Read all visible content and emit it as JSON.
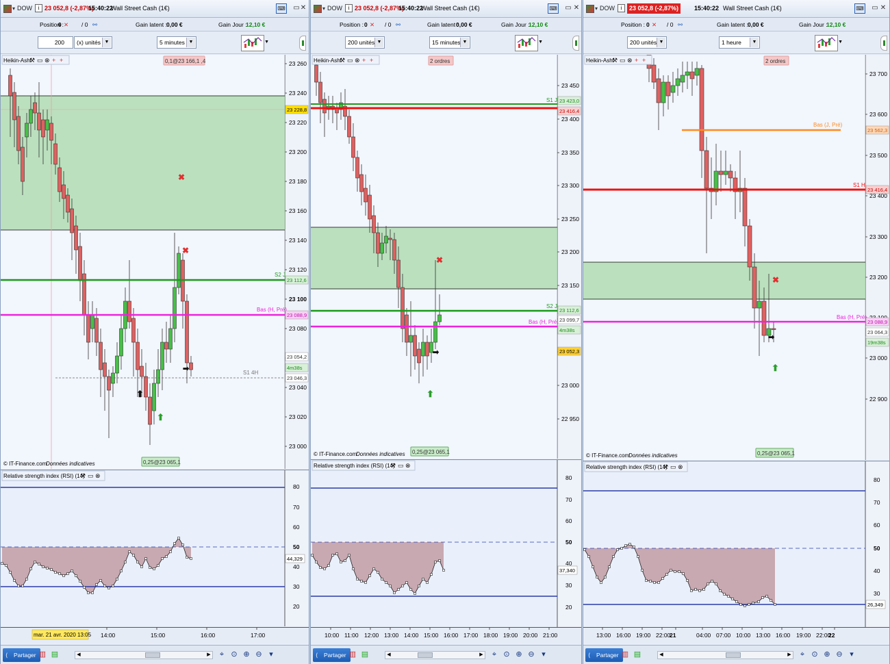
{
  "windows": [
    {
      "symbol": "DOW",
      "price_change": "23 052,8 (-2,87%)",
      "time": "15:40:22",
      "instrument": "Wall Street Cash (1€)",
      "position_label": "Position :",
      "position_value": "0",
      "position_sep": "/ 0",
      "latent_label": "Gain latent :",
      "latent_value": "0,00 €",
      "gain_label": "Gain Jour :",
      "gain_value": "12,10 €",
      "qty_value": "200",
      "units_select": "(x) unités",
      "period_select": "5 minutes",
      "indicator_label": "Heikin-Ashi",
      "order_badge": "0,1@23 166,1 ,4",
      "source_label": "© IT-Finance.com",
      "source_note": "Données indicatives",
      "fill_badge": "0,25@23 065,1",
      "rsi_label": "Relative strength index (RSI) (14)",
      "price_axis": [
        "23 260",
        "23 240",
        "23 220",
        "23 200",
        "23 180",
        "23 160",
        "23 140",
        "23 120",
        "23 100",
        "23 080",
        "23 060",
        "23 040",
        "23 020",
        "23 000"
      ],
      "price_tags": [
        {
          "text": "23 228,8",
          "kind": "yellow"
        },
        {
          "text": "23 112,6",
          "kind": "green"
        },
        {
          "text": "23 088,9",
          "kind": "magenta"
        },
        {
          "text": "23 054,2",
          "kind": "plain"
        },
        {
          "text": "4m38s",
          "kind": "green"
        },
        {
          "text": "23 046,3",
          "kind": "plain"
        }
      ],
      "line_labels": [
        {
          "text": "S2 J",
          "kind": "green"
        },
        {
          "text": "Bas (H, Pré)",
          "kind": "magenta"
        },
        {
          "text": "S1 4H",
          "kind": "gray"
        }
      ],
      "rsi_axis": [
        "80",
        "70",
        "60",
        "50",
        "40",
        "30",
        "20"
      ],
      "rsi_value": "44,329",
      "time_axis": [
        "14:00",
        "15:00",
        "16:00",
        "17:00"
      ],
      "date_cursor": "mar. 21 avr. 2020 13:05",
      "share_label": "Partager"
    },
    {
      "symbol": "DOW",
      "price_change": "23 052,8 (-2,87%)",
      "time": "15:40:22",
      "instrument": "Wall Street Cash (1€)",
      "position_label": "Position :",
      "position_value": "0",
      "position_sep": "/ 0",
      "latent_label": "Gain latent :",
      "latent_value": "0,00 €",
      "gain_label": "Gain Jour :",
      "gain_value": "12,10 €",
      "units_select": "200 unités",
      "period_select": "15 minutes",
      "indicator_label": "Heikin-Ashi",
      "order_badge": "2 ordres",
      "source_label": "© IT-Finance.com",
      "source_note": "Données indicatives",
      "fill_badge": "0,25@23 065,1",
      "rsi_label": "Relative strength index (RSI) (14)",
      "price_axis": [
        "23 450",
        "23 400",
        "23 350",
        "23 300",
        "23 250",
        "23 200",
        "23 150",
        "23 100",
        "23 050",
        "23 000",
        "22 950"
      ],
      "price_tags": [
        {
          "text": "23 423,0",
          "kind": "green"
        },
        {
          "text": "23 416,4",
          "kind": "red"
        },
        {
          "text": "23 112,6",
          "kind": "green"
        },
        {
          "text": "23 099,7",
          "kind": "plain"
        },
        {
          "text": "4m38s",
          "kind": "green"
        },
        {
          "text": "23 052,3",
          "kind": "yellow"
        }
      ],
      "line_labels": [
        {
          "text": "S1 J",
          "kind": "green"
        },
        {
          "text": "S2 J",
          "kind": "green"
        },
        {
          "text": "Bas (H, Pré)",
          "kind": "magenta"
        }
      ],
      "rsi_axis": [
        "80",
        "70",
        "60",
        "50",
        "40",
        "30",
        "20"
      ],
      "rsi_value": "37,340",
      "time_axis": [
        "10:00",
        "11:00",
        "12:00",
        "13:00",
        "14:00",
        "15:00",
        "16:00",
        "17:00",
        "18:00",
        "19:00",
        "20:00",
        "21:00"
      ],
      "share_label": "Partager"
    },
    {
      "symbol": "DOW",
      "price_change": "23 052,8 (-2,87%)",
      "time": "15:40:22",
      "instrument": "Wall Street Cash (1€)",
      "position_label": "Position :",
      "position_value": "0",
      "position_sep": "/ 0",
      "latent_label": "Gain latent :",
      "latent_value": "0,00 €",
      "gain_label": "Gain Jour :",
      "gain_value": "12,10 €",
      "units_select": "200 unités",
      "period_select": "1 heure",
      "indicator_label": "Heikin-Ashi",
      "order_badge": "2 ordres",
      "source_label": "© IT-Finance.com",
      "source_note": "Données indicatives",
      "fill_badge": "0,25@23 065,1",
      "rsi_label": "Relative strength index (RSI) (14)",
      "price_axis": [
        "23 700",
        "23 600",
        "23 500",
        "23 400",
        "23 300",
        "23 200",
        "23 100",
        "23 000",
        "22 900"
      ],
      "price_tags": [
        {
          "text": "23 562,3",
          "kind": "orange"
        },
        {
          "text": "23 416,4",
          "kind": "red"
        },
        {
          "text": "23 088,9",
          "kind": "magenta"
        },
        {
          "text": "23 064,3",
          "kind": "plain"
        },
        {
          "text": "19m38s",
          "kind": "green"
        }
      ],
      "line_labels": [
        {
          "text": "Bas (J, Pré)",
          "kind": "orange"
        },
        {
          "text": "S1 H",
          "kind": "red"
        },
        {
          "text": "Bas (H, Pré)",
          "kind": "magenta"
        }
      ],
      "rsi_axis": [
        "80",
        "70",
        "60",
        "50",
        "40",
        "30"
      ],
      "rsi_value": "26,349",
      "time_axis": [
        "13:00",
        "16:00",
        "19:00",
        "22:00",
        "21",
        "04:00",
        "07:00",
        "10:00",
        "13:00",
        "16:00",
        "19:00",
        "22:00",
        "22"
      ],
      "share_label": "Partager"
    }
  ],
  "colors": {
    "up": "#46c046",
    "down": "#e06060",
    "zone": "#a8d8a8",
    "s_green": "#1a9a1a",
    "s_red": "#ee1111",
    "magenta": "#ee22dd",
    "orange": "#ff8a20",
    "rsi_band": "#2a3aa8",
    "rsi_fill": "#c4a0a8"
  },
  "icons": [
    "window-icon",
    "keyboard-icon",
    "minimize-icon",
    "close-icon",
    "wrench-icon",
    "share-icon",
    "zoom-in-icon",
    "zoom-out-icon"
  ]
}
